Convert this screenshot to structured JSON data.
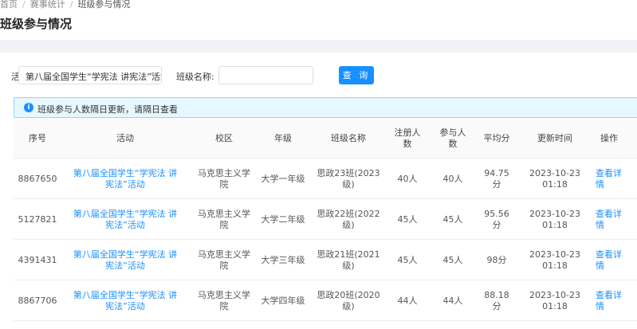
{
  "breadcrumb": {
    "home": "首页",
    "sep": "/",
    "level2": "赛事统计",
    "current": "班级参与情况"
  },
  "page_title": "班级参与情况",
  "filter": {
    "activity_label": "活",
    "activity_value": "第八届全国学生“学宪法 讲宪法”活动",
    "class_label": "班级名称:",
    "class_value": "",
    "search_button": "查 询"
  },
  "notice": {
    "icon": "info-icon",
    "text": "班级参与人数隔日更新，请隔日查看"
  },
  "table": {
    "headers": [
      "序号",
      "活动",
      "校区",
      "年级",
      "班级名称",
      "注册人数",
      "参与人数",
      "平均分",
      "更新时间",
      "操作"
    ],
    "rows": [
      [
        "8867650",
        "第八届全国学生“学宪法 讲宪法”活动",
        "马克思主义学院",
        "大学一年级",
        "思政23班(2023级)",
        "40人",
        "40人",
        "94.75分",
        "2023-10-23 01:18",
        "查看详情"
      ],
      [
        "5127821",
        "第八届全国学生“学宪法 讲宪法”活动",
        "马克思主义学院",
        "大学二年级",
        "思政22班(2022级)",
        "45人",
        "45人",
        "95.56分",
        "2023-10-23 01:18",
        "查看详情"
      ],
      [
        "4391431",
        "第八届全国学生“学宪法 讲宪法”活动",
        "马克思主义学院",
        "大学三年级",
        "思政21班(2021级)",
        "45人",
        "45人",
        "98分",
        "2023-10-23 01:18",
        "查看详情"
      ],
      [
        "8867706",
        "第八届全国学生“学宪法 讲宪法”活动",
        "马克思主义学院",
        "大学四年级",
        "思政20班(2020级)",
        "44人",
        "44人",
        "88.18分",
        "2023-10-23 01:18",
        "查看详情"
      ]
    ]
  },
  "colors": {
    "accent": "#1890ff",
    "notice_bg": "#e6f7ff",
    "notice_border": "#91d5ff"
  }
}
